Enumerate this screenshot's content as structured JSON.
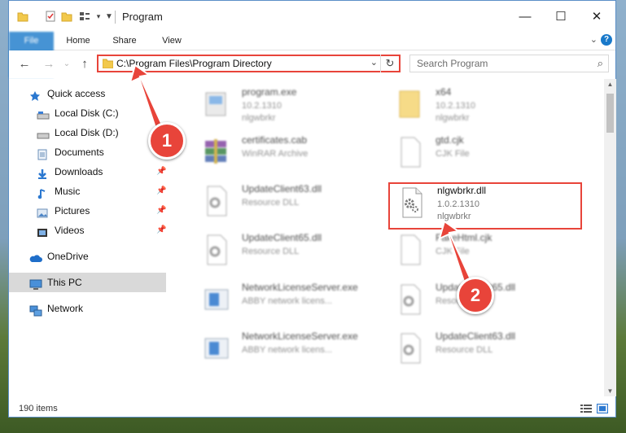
{
  "window": {
    "title": "Program"
  },
  "ribbon": {
    "tabs": [
      "File",
      "Home",
      "Share",
      "View"
    ],
    "help": "?"
  },
  "nav": {
    "back": "←",
    "forward": "→",
    "up": "↑",
    "address": "C:\\Program Files\\Program Directory",
    "search_placeholder": "Search Program"
  },
  "sidebar": {
    "items": [
      {
        "label": "Quick access",
        "icon": "star-icon"
      },
      {
        "label": "Local Disk (C:)",
        "icon": "drive-icon"
      },
      {
        "label": "Local Disk (D:)",
        "icon": "drive-icon"
      },
      {
        "label": "Documents",
        "icon": "documents-icon"
      },
      {
        "label": "Downloads",
        "icon": "download-icon"
      },
      {
        "label": "Music",
        "icon": "music-icon"
      },
      {
        "label": "Pictures",
        "icon": "pictures-icon"
      },
      {
        "label": "Videos",
        "icon": "videos-icon"
      },
      {
        "label": "OneDrive",
        "icon": "cloud-icon"
      },
      {
        "label": "This PC",
        "icon": "computer-icon"
      },
      {
        "label": "Network",
        "icon": "network-icon"
      }
    ]
  },
  "files": [
    {
      "name": "program.exe",
      "line2": "10.2.1310",
      "line3": "nlgwbrkr",
      "icon": "exe-icon"
    },
    {
      "name": "x64",
      "line2": "10.2.1310",
      "line3": "nlgwbrkr",
      "icon": "folder-icon"
    },
    {
      "name": "certificates.cab",
      "line2": "WinRAR Archive",
      "line3": "",
      "icon": "archive-icon"
    },
    {
      "name": "gtd.cjk",
      "line2": "CJK File",
      "line3": "",
      "icon": "blank-file-icon"
    },
    {
      "name": "UpdateClient63.dll",
      "line2": "Resource DLL",
      "line3": "",
      "icon": "dll-icon"
    },
    {
      "name": "nlgwbrkr.dll",
      "line2": "1.0.2.1310",
      "line3": "nlgwbrkr",
      "icon": "dll-icon"
    },
    {
      "name": "UpdateClient65.dll",
      "line2": "Resource DLL",
      "line3": "",
      "icon": "dll-icon"
    },
    {
      "name": "FakeHtml.cjk",
      "line2": "CJK File",
      "line3": "",
      "icon": "blank-file-icon"
    },
    {
      "name": "NetworkLicenseServer.exe",
      "line2": "ABBY network licens...",
      "line3": "",
      "icon": "app-icon"
    },
    {
      "name": "UpdateClient65.dll",
      "line2": "Resource DLL",
      "line3": "",
      "icon": "dll-icon"
    },
    {
      "name": "NetworkLicenseServer.exe",
      "line2": "ABBY network licens...",
      "line3": "",
      "icon": "app-icon"
    },
    {
      "name": "UpdateClient63.dll",
      "line2": "Resource DLL",
      "line3": "",
      "icon": "dll-icon"
    }
  ],
  "status": {
    "item_count": "190 items"
  },
  "annotations": {
    "step1": "1",
    "step2": "2",
    "color": "#e8443a"
  }
}
